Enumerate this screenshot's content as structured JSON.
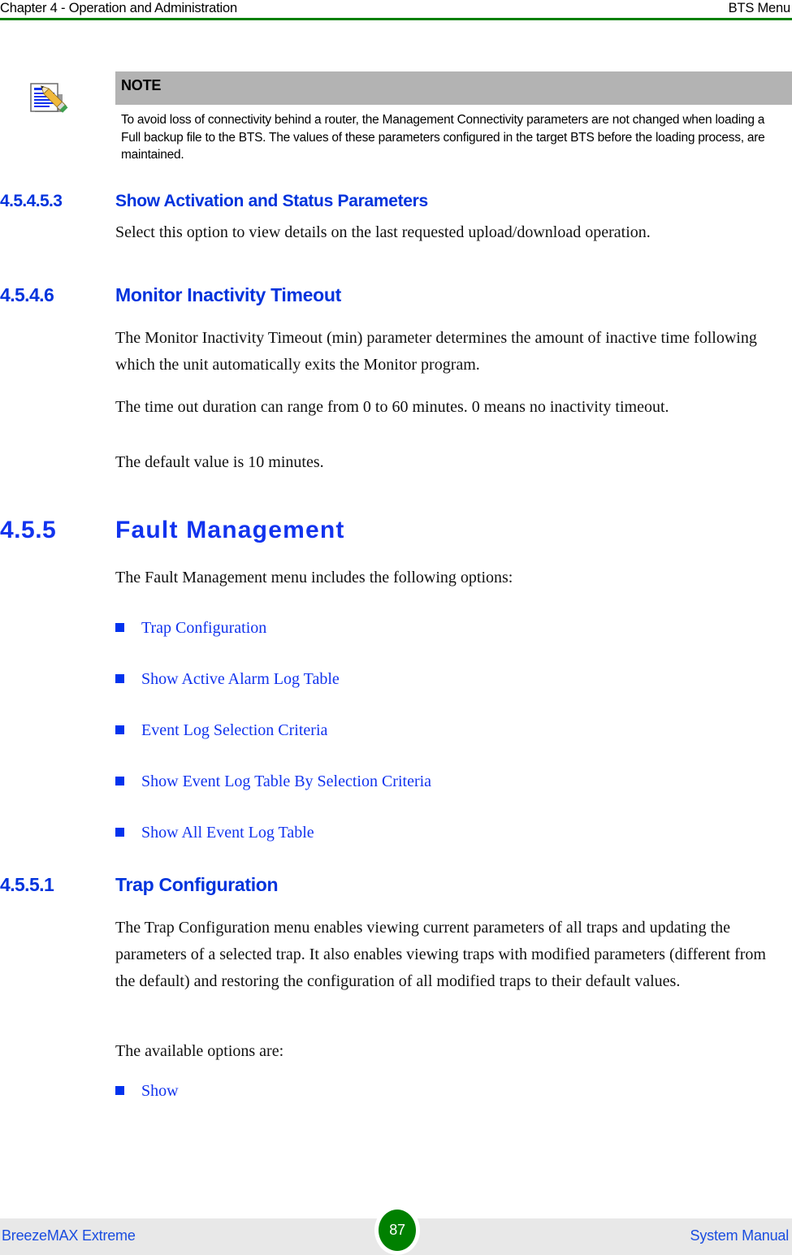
{
  "header": {
    "left": "Chapter 4 - Operation and Administration",
    "right": "BTS Menu",
    "rule_color": "#008000"
  },
  "note": {
    "icon": "notepad-pencil-icon",
    "title": "NOTE",
    "text": "To avoid loss of connectivity behind a router, the Management Connectivity parameters are not changed when loading a Full backup file to the BTS. The values of these parameters configured in the target BTS before the loading process, are maintained.",
    "band_color": "#b3b3b3"
  },
  "sections": {
    "heading_color": "#0033dd",
    "h2_color": "#1133ee",
    "s1": {
      "number": "4.5.4.5.3",
      "title": "Show Activation and Status Parameters",
      "body": "Select this option to view details on the last requested upload/download operation."
    },
    "s2": {
      "number": "4.5.4.6",
      "title": "Monitor Inactivity Timeout",
      "p1": "The Monitor Inactivity Timeout (min) parameter determines the amount of inactive time following which the unit automatically exits the Monitor program.",
      "p2": "The time out duration can range from 0 to 60 minutes. 0 means no inactivity timeout.",
      "p3": "The default value is 10 minutes."
    },
    "s3": {
      "number": "4.5.5",
      "title": "Fault Management",
      "intro": "The Fault Management menu includes the following options:",
      "links": [
        "Trap Configuration",
        "Show Active Alarm Log Table",
        "Event Log Selection Criteria",
        "Show Event Log Table By Selection Criteria",
        "Show All Event Log Table"
      ]
    },
    "s4": {
      "number": "4.5.5.1",
      "title": "Trap Configuration",
      "p1": "The Trap Configuration menu enables viewing current parameters of all traps and updating the parameters of a selected trap. It also enables viewing traps with modified parameters (different from the default) and restoring the configuration of all modified traps to their default values.",
      "p2": "The available options are:",
      "links": [
        "Show"
      ]
    }
  },
  "footer": {
    "left": "BreezeMAX Extreme",
    "page_number": "87",
    "right": "System Manual",
    "band_color": "#e8e8e8",
    "badge_color": "#008000"
  }
}
